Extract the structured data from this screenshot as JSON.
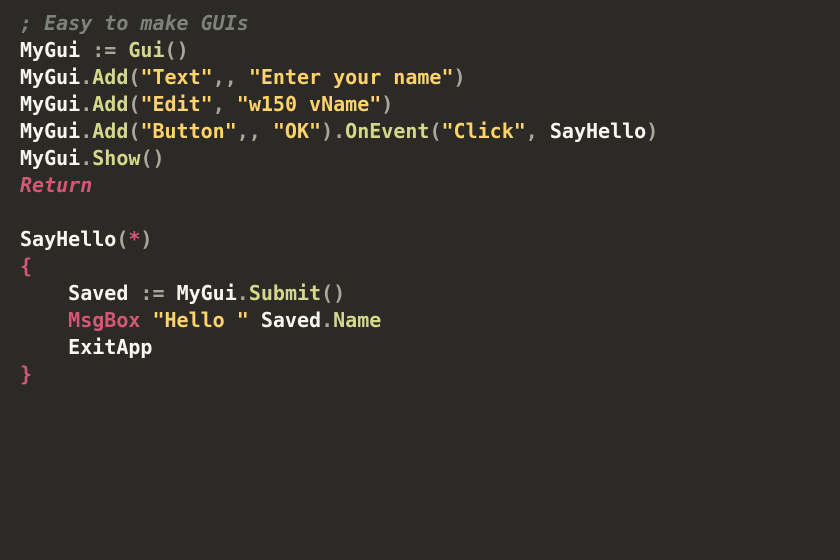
{
  "code": {
    "l1": {
      "comment": "; Easy to make GUIs"
    },
    "l2": {
      "a": "MyGui",
      "assign": " := ",
      "b": "Gui",
      "p1": "(",
      "p2": ")"
    },
    "l3": {
      "a": "MyGui",
      "dot": ".",
      "m": "Add",
      "p1": "(",
      "s1": "\"Text\"",
      "c1": ",, ",
      "s2": "\"Enter your name\"",
      "p2": ")"
    },
    "l4": {
      "a": "MyGui",
      "dot": ".",
      "m": "Add",
      "p1": "(",
      "s1": "\"Edit\"",
      "c1": ", ",
      "s2": "\"w150 vName\"",
      "p2": ")"
    },
    "l5": {
      "a": "MyGui",
      "dot": ".",
      "m": "Add",
      "p1": "(",
      "s1": "\"Button\"",
      "c1": ",, ",
      "s2": "\"OK\"",
      "p2": ")",
      "dot2": ".",
      "m2": "OnEvent",
      "p3": "(",
      "s3": "\"Click\"",
      "c2": ", ",
      "cb": "SayHello",
      "p4": ")"
    },
    "l6": {
      "a": "MyGui",
      "dot": ".",
      "m": "Show",
      "p1": "(",
      "p2": ")"
    },
    "l7": {
      "kw": "Return"
    },
    "l8": {
      "blank": ""
    },
    "l9": {
      "fn": "SayHello",
      "p1": "(",
      "star": "*",
      "p2": ")"
    },
    "l10": {
      "brace": "{"
    },
    "l11": {
      "indent": "    ",
      "a": "Saved",
      "assign": " := ",
      "b": "MyGui",
      "dot": ".",
      "m": "Submit",
      "p1": "(",
      "p2": ")"
    },
    "l12": {
      "indent": "    ",
      "cmd": "MsgBox",
      "sp": " ",
      "s1": "\"Hello \"",
      "sp2": " ",
      "b": "Saved",
      "dot": ".",
      "prop": "Name"
    },
    "l13": {
      "indent": "    ",
      "cmd": "ExitApp"
    },
    "l14": {
      "brace": "}"
    }
  }
}
